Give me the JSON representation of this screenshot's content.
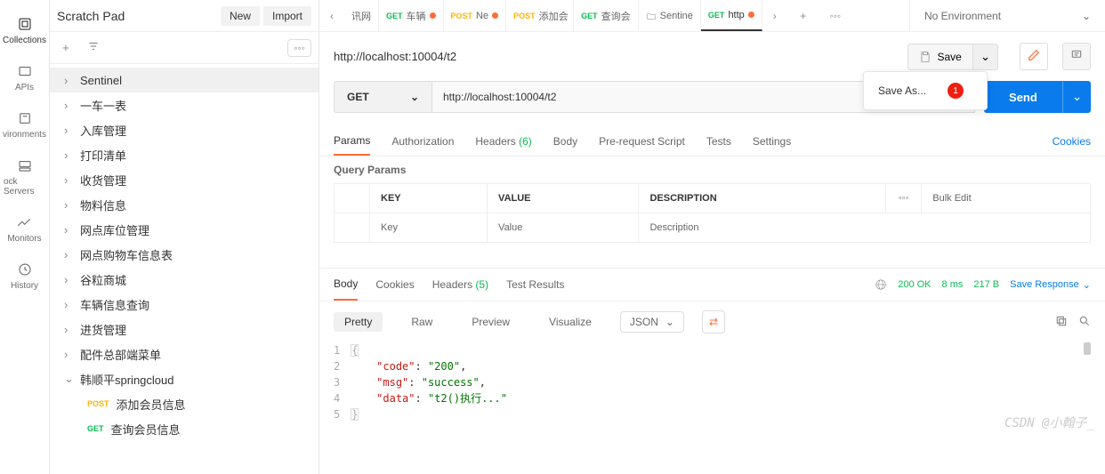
{
  "leftNav": {
    "items": [
      {
        "label": "Collections"
      },
      {
        "label": "APIs"
      },
      {
        "label": "vironments"
      },
      {
        "label": "ock Servers"
      },
      {
        "label": "Monitors"
      },
      {
        "label": "History"
      }
    ]
  },
  "scratch": {
    "title": "Scratch Pad",
    "new": "New",
    "import": "Import"
  },
  "tree": {
    "items": [
      {
        "label": "Sentinel",
        "selected": true
      },
      {
        "label": "一车一表"
      },
      {
        "label": "入库管理"
      },
      {
        "label": "打印清单"
      },
      {
        "label": "收货管理"
      },
      {
        "label": "物料信息"
      },
      {
        "label": "网点库位管理"
      },
      {
        "label": "网点购物车信息表"
      },
      {
        "label": "谷粒商城"
      },
      {
        "label": "车辆信息查询"
      },
      {
        "label": "进货管理"
      },
      {
        "label": "配件总部端菜单"
      },
      {
        "label": "韩顺平springcloud",
        "expanded": true,
        "children": [
          {
            "method": "POST",
            "label": "添加会员信息"
          },
          {
            "method": "GET",
            "label": "查询会员信息"
          }
        ]
      }
    ]
  },
  "tabs": {
    "list": [
      {
        "label": "讯网"
      },
      {
        "method": "GET",
        "label": "车辆",
        "dot": true
      },
      {
        "method": "POST",
        "label": "Ne",
        "dot": true
      },
      {
        "method": "POST",
        "label": "添加会"
      },
      {
        "method": "GET",
        "label": "查询会"
      },
      {
        "icon": true,
        "label": "Sentine"
      },
      {
        "method": "GET",
        "label": "http",
        "dot": true,
        "active": true
      }
    ],
    "env": "No Environment"
  },
  "request": {
    "title": "http://localhost:10004/t2",
    "save": "Save",
    "saveAs": "Save As...",
    "saveBadge": "1",
    "method": "GET",
    "url": "http://localhost:10004/t2",
    "send": "Send"
  },
  "reqTabs": {
    "params": "Params",
    "auth": "Authorization",
    "headers": "Headers",
    "headersCount": "(6)",
    "body": "Body",
    "prescript": "Pre-request Script",
    "tests": "Tests",
    "settings": "Settings",
    "cookies": "Cookies"
  },
  "queryParams": {
    "heading": "Query Params",
    "key": "KEY",
    "value": "VALUE",
    "desc": "DESCRIPTION",
    "bulk": "Bulk Edit",
    "keyPh": "Key",
    "valuePh": "Value",
    "descPh": "Description"
  },
  "respTabs": {
    "body": "Body",
    "cookies": "Cookies",
    "headers": "Headers",
    "headersCount": "(5)",
    "results": "Test Results"
  },
  "respMeta": {
    "status": "200 OK",
    "time": "8 ms",
    "size": "217 B",
    "saveResp": "Save Response"
  },
  "bodyView": {
    "pretty": "Pretty",
    "raw": "Raw",
    "preview": "Preview",
    "visualize": "Visualize",
    "format": "JSON"
  },
  "responseBody": {
    "line1": "{",
    "k1": "\"code\"",
    "v1": "\"200\"",
    "k2": "\"msg\"",
    "v2": "\"success\"",
    "k3": "\"data\"",
    "v3": "\"t2()执行...\"",
    "line5": "}"
  },
  "watermark": "CSDN @小翰子_"
}
